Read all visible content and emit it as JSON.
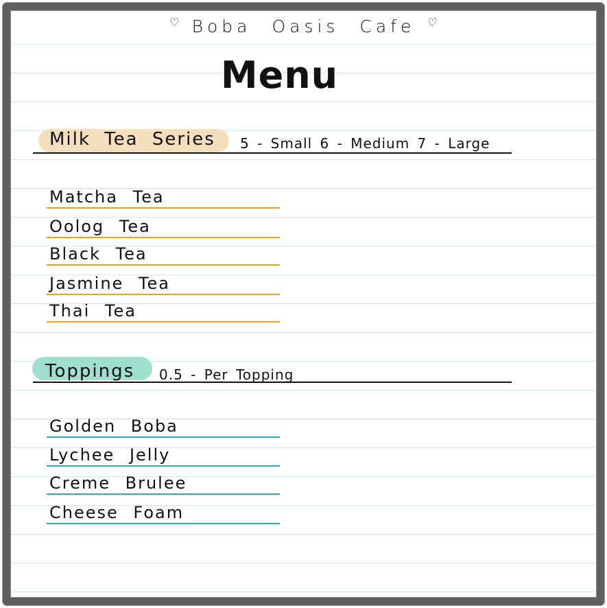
{
  "header": {
    "cafe_name": "Boba Oasis Cafe",
    "heart_left": "♡",
    "heart_right": "♡",
    "title": "Menu"
  },
  "milk_tea": {
    "section_title": "Milk Tea Series",
    "price_note": "5 - Small  6 - Medium  7 - Large",
    "accent_color": "#f4dfbd",
    "underline_color": "#f0a018",
    "items": [
      {
        "label": "Matcha Tea"
      },
      {
        "label": "Oolog Tea"
      },
      {
        "label": "Black Tea"
      },
      {
        "label": "Jasmine Tea"
      },
      {
        "label": "Thai Tea"
      }
    ]
  },
  "toppings": {
    "section_title": "Toppings",
    "price_note": "0.5 - Per Topping",
    "accent_color": "#9fdfd0",
    "underline_color": "#2ab0a0",
    "items": [
      {
        "label": "Golden Boba"
      },
      {
        "label": "Lychee Jelly"
      },
      {
        "label": "Creme Brulee"
      },
      {
        "label": "Cheese Foam"
      }
    ]
  }
}
